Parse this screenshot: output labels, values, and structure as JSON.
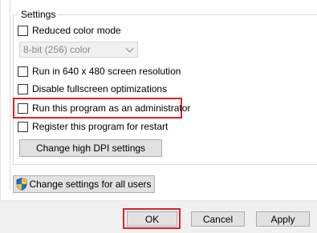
{
  "settings": {
    "group_label": "Settings",
    "reduced_color_mode": {
      "label": "Reduced color mode",
      "checked": false
    },
    "color_select": {
      "value": "8-bit (256) color",
      "disabled": true
    },
    "run_640x480": {
      "label": "Run in 640 x 480 screen resolution",
      "checked": false
    },
    "disable_fullscreen_opt": {
      "label": "Disable fullscreen optimizations",
      "checked": false
    },
    "run_as_admin": {
      "label": "Run this program as an administrator",
      "checked": false,
      "highlighted": true
    },
    "register_restart": {
      "label": "Register this program for restart",
      "checked": false
    },
    "dpi_button": "Change high DPI settings"
  },
  "all_users_button": {
    "label": "Change settings for all users",
    "icon": "uac-shield-icon"
  },
  "footer": {
    "ok": "OK",
    "cancel": "Cancel",
    "apply": "Apply"
  },
  "colors": {
    "highlight": "#d9232e",
    "button_face": "#e1e1e1",
    "footer_bg": "#f0f0f0"
  }
}
